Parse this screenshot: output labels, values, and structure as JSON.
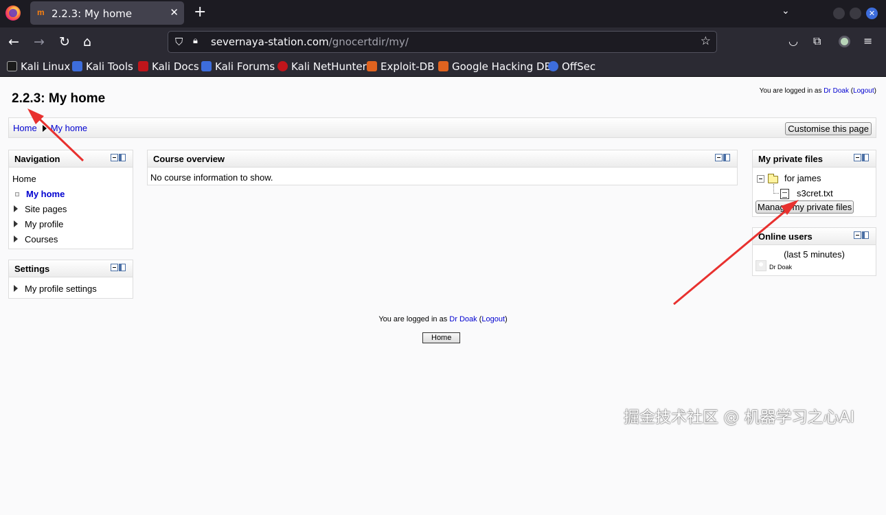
{
  "browser": {
    "tab_title": "2.2.3: My home",
    "tab_favicon": "moodle-icon",
    "url_domain": "severnaya-station.com",
    "url_path": "/gnocertdir/my/",
    "bookmarks": [
      {
        "label": "Kali Linux",
        "color": "#1b1b1b"
      },
      {
        "label": "Kali Tools",
        "color": "#3d6ddc"
      },
      {
        "label": "Kali Docs",
        "color": "#c0151b"
      },
      {
        "label": "Kali Forums",
        "color": "#3d6ddc"
      },
      {
        "label": "Kali NetHunter",
        "color": "#c0151b"
      },
      {
        "label": "Exploit-DB",
        "color": "#e0631f"
      },
      {
        "label": "Google Hacking DB",
        "color": "#e0631f"
      },
      {
        "label": "OffSec",
        "color": "#3d6ddc"
      }
    ]
  },
  "page": {
    "title": "2.2.3: My home",
    "login": {
      "prefix": "You are logged in as",
      "user": "Dr Doak",
      "logout": "Logout"
    },
    "breadcrumb": {
      "home": "Home",
      "current": "My home"
    },
    "customise_button": "Customise this page",
    "navigation": {
      "title": "Navigation",
      "home": "Home",
      "items": [
        "My home",
        "Site pages",
        "My profile",
        "Courses"
      ]
    },
    "settings": {
      "title": "Settings",
      "items": [
        "My profile settings"
      ]
    },
    "course_overview": {
      "title": "Course overview",
      "message": "No course information to show."
    },
    "private_files": {
      "title": "My private files",
      "folder": "for james",
      "file": "s3cret.txt",
      "manage_button": "Manage my private files"
    },
    "online_users": {
      "title": "Online users",
      "period": "(last 5 minutes)",
      "users": [
        "Dr Doak"
      ]
    },
    "home_button": "Home"
  },
  "annotations": {
    "arrow_color": "#e8312f"
  },
  "watermark": "掘金技术社区 @ 机器学习之心AI"
}
